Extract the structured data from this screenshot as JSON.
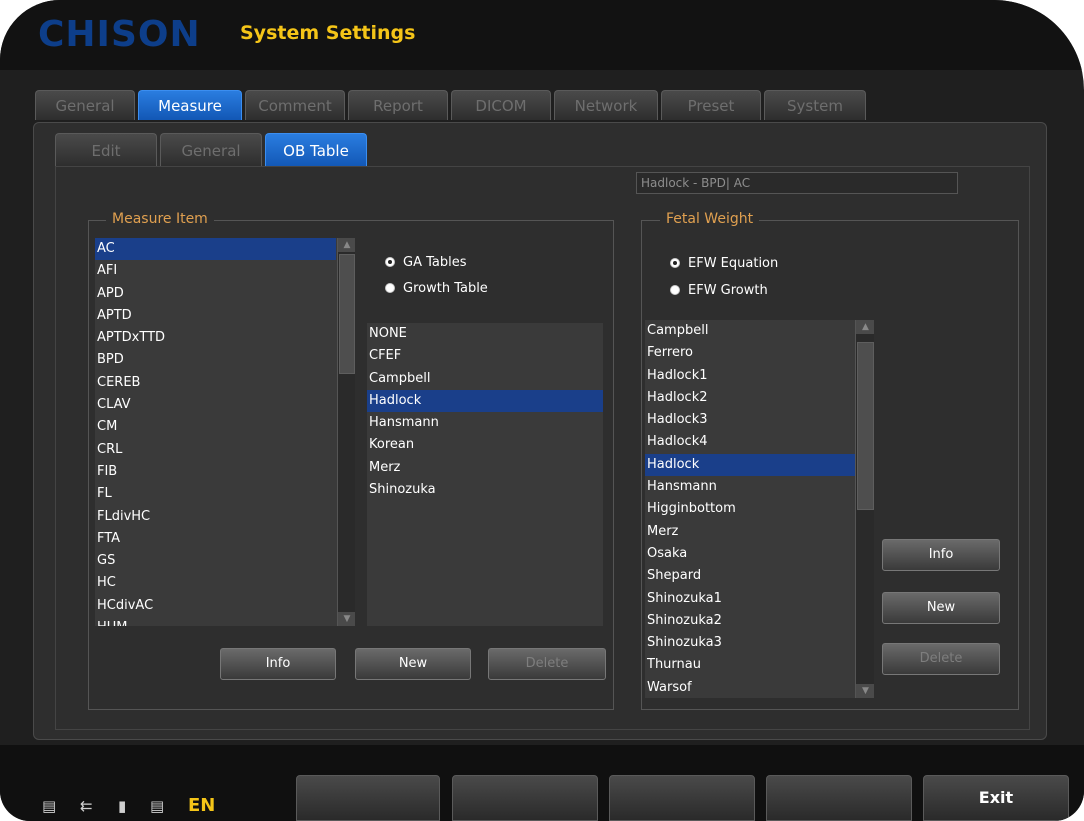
{
  "header": {
    "logo": "CHISON",
    "title": "System Settings"
  },
  "tabs": [
    "General",
    "Measure",
    "Comment",
    "Report",
    "DICOM",
    "Network",
    "Preset",
    "System"
  ],
  "sub_tabs": [
    "Edit",
    "General",
    "OB Table"
  ],
  "formula_display": "Hadlock - BPD| AC",
  "measure_item": {
    "legend": "Measure Item",
    "items": [
      "AC",
      "AFI",
      "APD",
      "APTD",
      "APTDxTTD",
      "BPD",
      "CEREB",
      "CLAV",
      "CM",
      "CRL",
      "FIB",
      "FL",
      "FLdivHC",
      "FTA",
      "GS",
      "HC",
      "HCdivAC",
      "HUM"
    ],
    "selected": "AC"
  },
  "table_type": {
    "options": [
      "GA Tables",
      "Growth Table"
    ],
    "selected": "GA Tables"
  },
  "authors": {
    "items": [
      "NONE",
      "CFEF",
      "Campbell",
      "Hadlock",
      "Hansmann",
      "Korean",
      "Merz",
      "Shinozuka"
    ],
    "selected": "Hadlock"
  },
  "left_buttons": {
    "info": "Info",
    "new": "New",
    "delete": "Delete"
  },
  "fetal_weight": {
    "legend": "Fetal Weight",
    "options": [
      "EFW Equation",
      "EFW Growth"
    ],
    "selected": "EFW Equation",
    "items": [
      "Campbell",
      "Ferrero",
      "Hadlock1",
      "Hadlock2",
      "Hadlock3",
      "Hadlock4",
      "Hadlock",
      "Hansmann",
      "Higginbottom",
      "Merz",
      "Osaka",
      "Shepard",
      "Shinozuka1",
      "Shinozuka2",
      "Shinozuka3",
      "Thurnau",
      "Warsof"
    ],
    "selected_item": "Hadlock"
  },
  "right_buttons": {
    "info": "Info",
    "new": "New",
    "delete": "Delete"
  },
  "footer": {
    "buttons": [
      "",
      "",
      "",
      "",
      "",
      "Exit"
    ],
    "status_icons": [
      "network-icon",
      "usb-icon",
      "disk-icon",
      "monitor-icon"
    ],
    "language": "EN"
  },
  "colors": {
    "accent_blue": "#1f6fd6",
    "title_yellow": "#f5c518",
    "legend_orange": "#e0a050",
    "selection_blue": "#1a3f8a"
  }
}
